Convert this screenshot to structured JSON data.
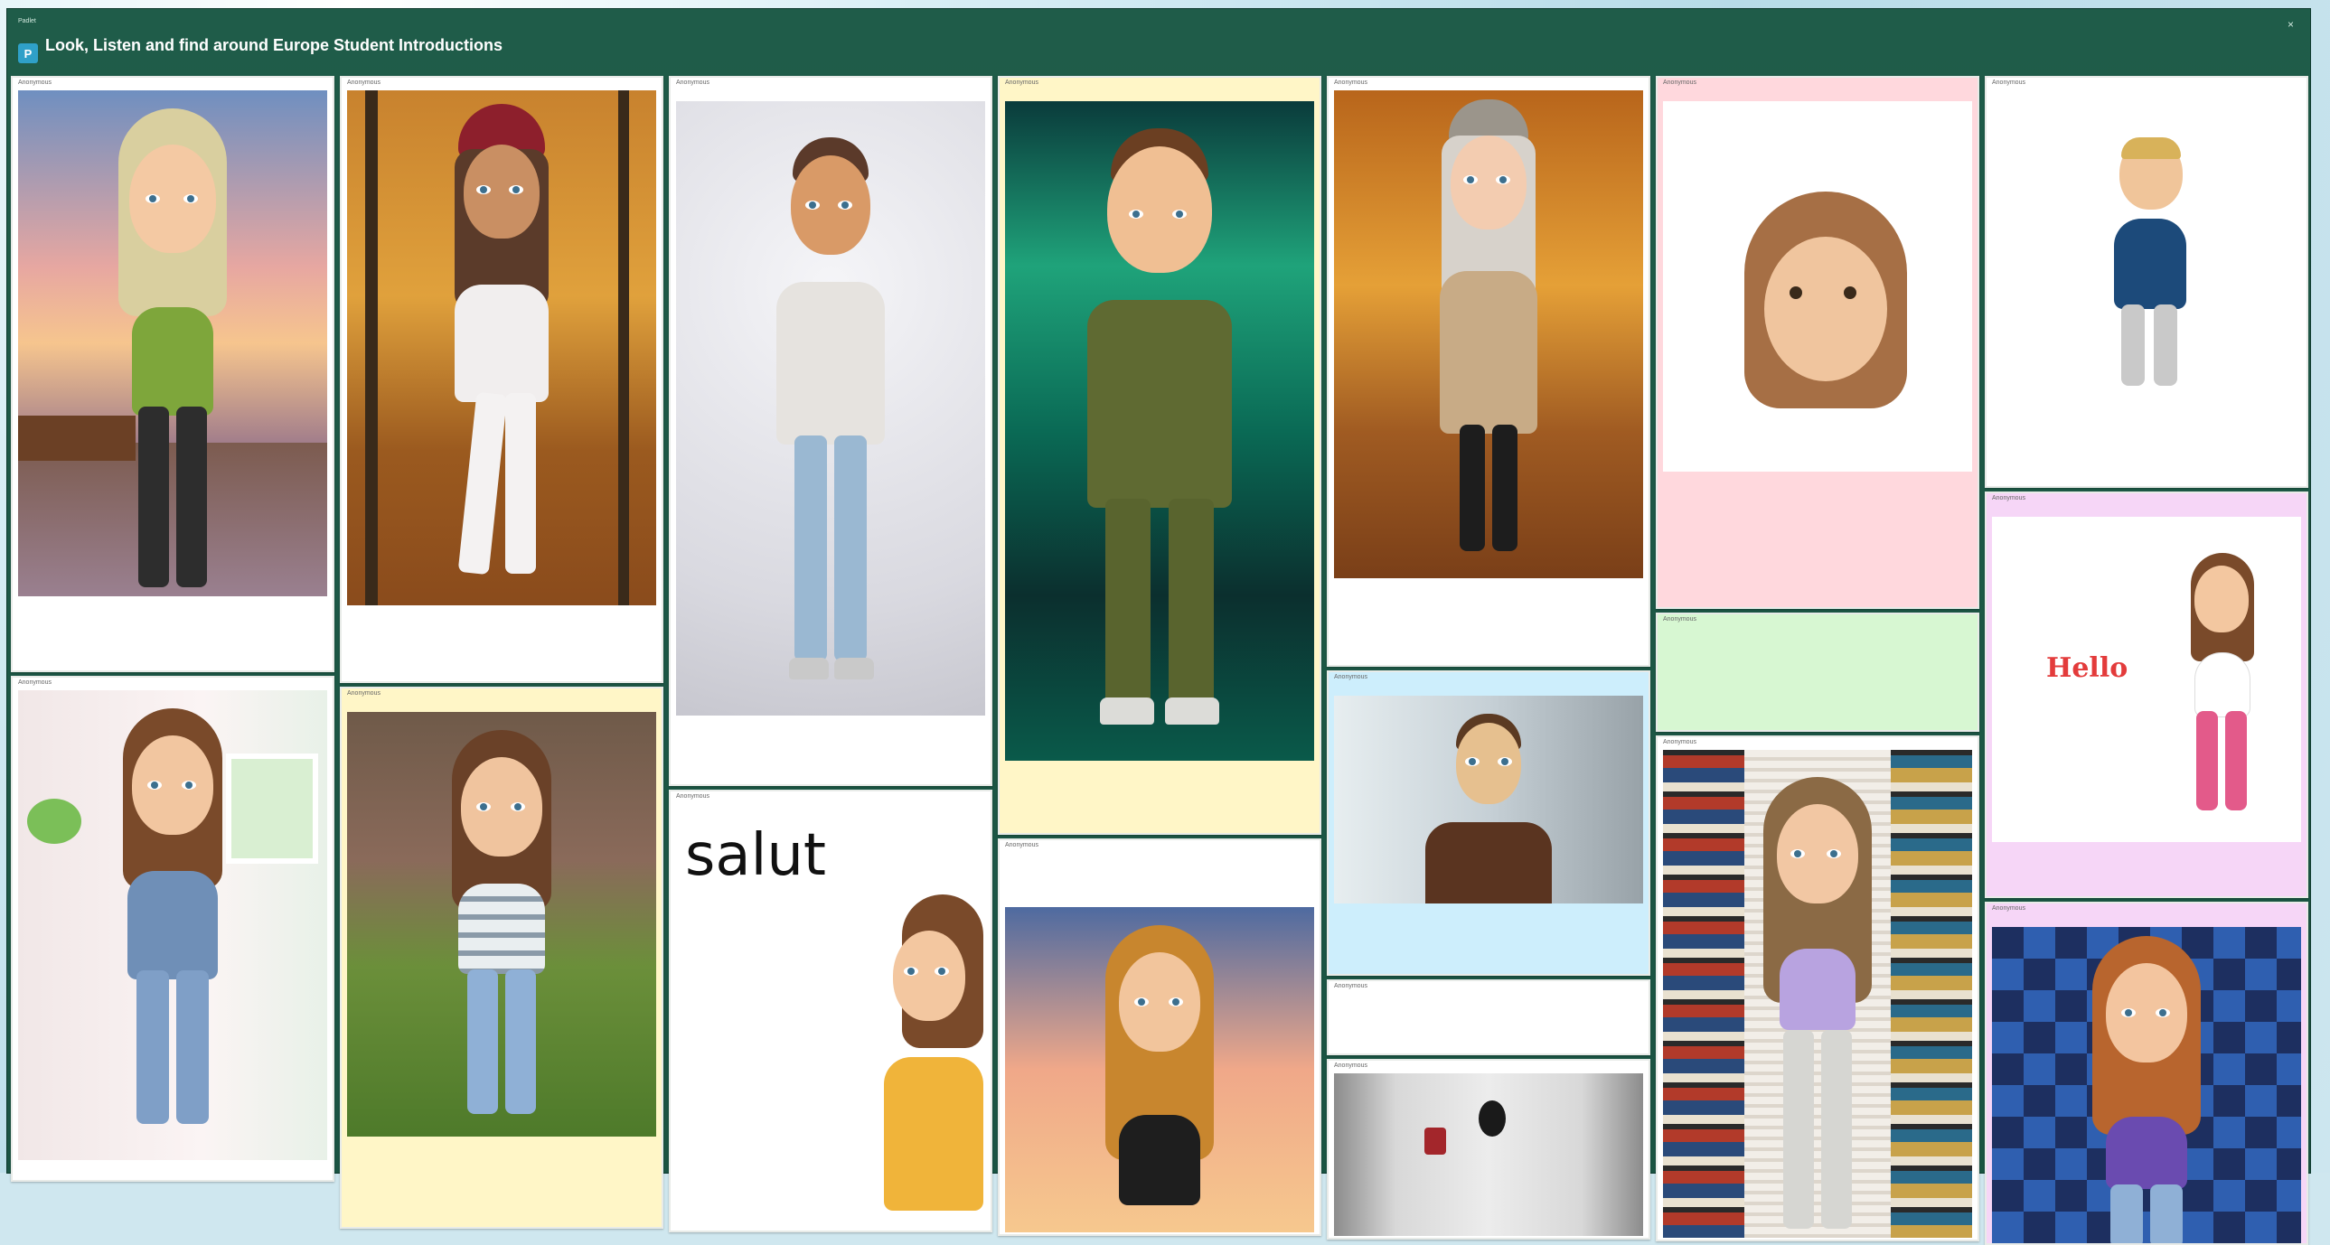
{
  "board": {
    "breadcrumb": "Padlet",
    "title": "Look, Listen and find around Europe Student Introductions",
    "subtitle": "",
    "logo_letter": "P",
    "close_symbol": "×"
  },
  "colors": {
    "board_bg": "#1d5846",
    "sky_bg": "#cfe7ef",
    "yellow": "#fff6c7",
    "pink": "#ffd8dd",
    "green": "#d7f7d2",
    "blue": "#cdeefc",
    "lilac": "#f6d6f7"
  },
  "cards": {
    "c1": {
      "author": "Anonymous",
      "subject": "",
      "body": "",
      "foot": ""
    },
    "c2": {
      "author": "Anonymous",
      "subject": "",
      "body": "",
      "foot": ""
    },
    "c3": {
      "author": "Anonymous",
      "subject": "",
      "body": "",
      "foot": ""
    },
    "c4": {
      "author": "Anonymous",
      "subject": "",
      "body": "",
      "foot": ""
    },
    "c5": {
      "author": "Anonymous",
      "subject": "",
      "body": "",
      "foot": ""
    },
    "c6": {
      "author": "Anonymous",
      "subject": "",
      "body": "",
      "foot": ""
    },
    "c7": {
      "author": "Anonymous",
      "subject": "",
      "body": "",
      "foot": ""
    },
    "c8": {
      "author": "Anonymous",
      "subject": "",
      "body": "",
      "foot": ""
    },
    "c9": {
      "author": "Anonymous",
      "subject": "",
      "body": "",
      "foot": ""
    },
    "c10": {
      "author": "Anonymous",
      "subject": "",
      "body": "",
      "foot": ""
    },
    "c11": {
      "author": "Anonymous",
      "subject": "",
      "body": "",
      "foot": ""
    },
    "c12": {
      "author": "Anonymous",
      "subject": "",
      "body": "",
      "foot": ""
    },
    "c13": {
      "author": "Anonymous",
      "subject": "",
      "body": "",
      "foot": ""
    },
    "c14": {
      "author": "Anonymous",
      "subject": "",
      "body": "",
      "foot": ""
    },
    "c15": {
      "author": "Anonymous",
      "subject": "",
      "body": "",
      "foot": ""
    },
    "c16": {
      "author": "Anonymous",
      "subject": "",
      "body": "",
      "foot": ""
    },
    "c17": {
      "author": "Anonymous",
      "subject": "",
      "body": "",
      "foot": ""
    },
    "c18": {
      "author": "Anonymous",
      "subject": "",
      "body": "",
      "foot": ""
    }
  },
  "image_text": {
    "salut": "salut",
    "hello": "Hello"
  }
}
